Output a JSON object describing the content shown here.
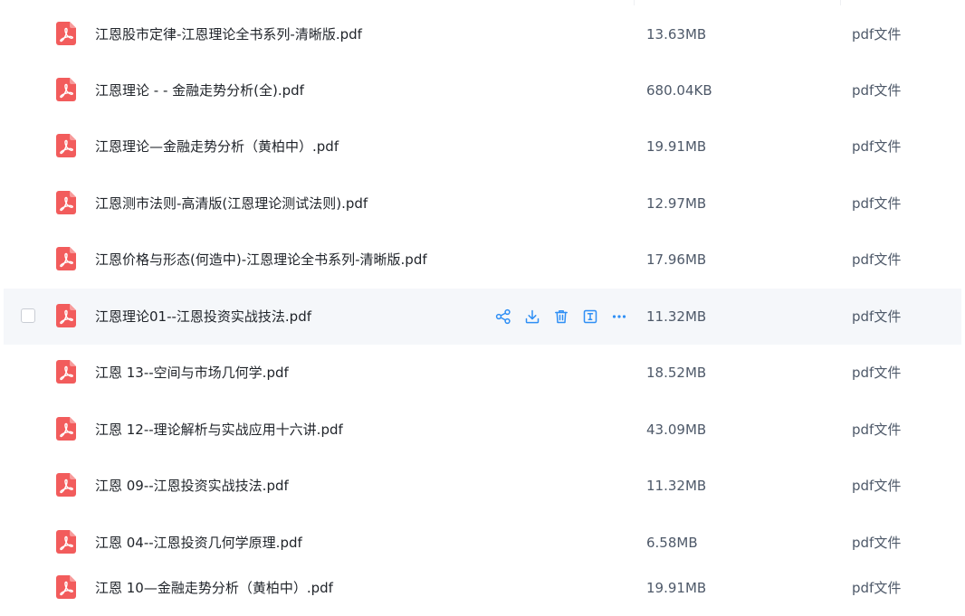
{
  "colors": {
    "pdf_icon": "#f25c5c",
    "action_icon": "#2f8ff5",
    "hover_row": "#f5f7fa",
    "text_primary": "#1f2329",
    "text_secondary": "#4e5969"
  },
  "icons": {
    "file": "pdf-file-icon",
    "share": "share-icon",
    "download": "download-icon",
    "delete": "trash-icon",
    "rename": "rename-icon",
    "more": "more-icon"
  },
  "files": [
    {
      "name": "江恩股市定律-江恩理论全书系列-清晰版.pdf",
      "size": "13.63MB",
      "type": "pdf文件"
    },
    {
      "name": "江恩理论 -   - 金融走势分析(全).pdf",
      "size": "680.04KB",
      "type": "pdf文件"
    },
    {
      "name": "江恩理论—金融走势分析（黄柏中）.pdf",
      "size": "19.91MB",
      "type": "pdf文件"
    },
    {
      "name": "江恩测市法则-高清版(江恩理论测试法则).pdf",
      "size": "12.97MB",
      "type": "pdf文件"
    },
    {
      "name": "江恩价格与形态(何造中)-江恩理论全书系列-清晰版.pdf",
      "size": "17.96MB",
      "type": "pdf文件"
    },
    {
      "name": "江恩理论01--江恩投资实战技法.pdf",
      "size": "11.32MB",
      "type": "pdf文件"
    },
    {
      "name": "江恩 13--空间与市场几何学.pdf",
      "size": "18.52MB",
      "type": "pdf文件"
    },
    {
      "name": "江恩 12--理论解析与实战应用十六讲.pdf",
      "size": "43.09MB",
      "type": "pdf文件"
    },
    {
      "name": "江恩 09--江恩投资实战技法.pdf",
      "size": "11.32MB",
      "type": "pdf文件"
    },
    {
      "name": "江恩 04--江恩投资几何学原理.pdf",
      "size": "6.58MB",
      "type": "pdf文件"
    },
    {
      "name": "江恩 10—金融走势分析（黄柏中）.pdf",
      "size": "19.91MB",
      "type": "pdf文件"
    }
  ]
}
